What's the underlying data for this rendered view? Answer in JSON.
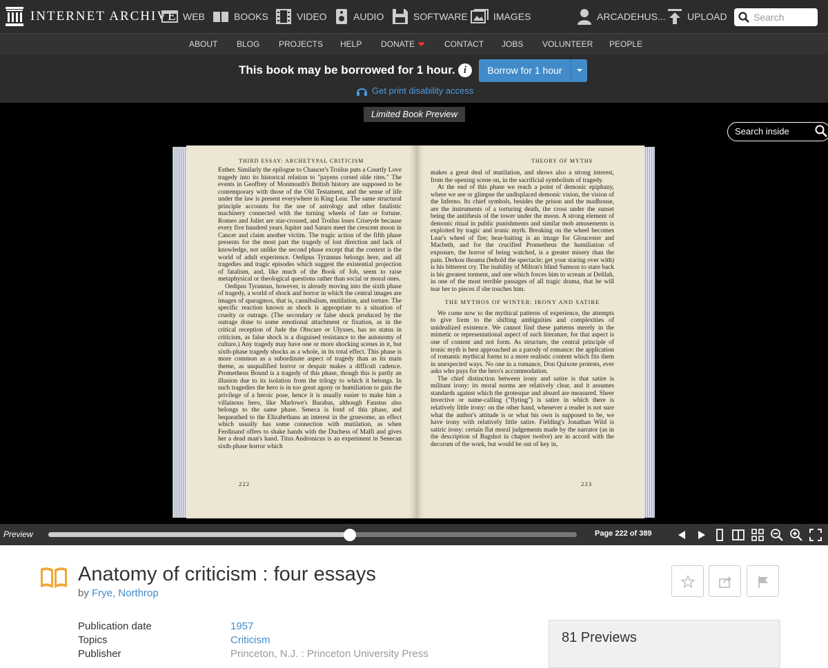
{
  "brand": {
    "name": "INTERNET ARCHIVE"
  },
  "topnav": {
    "items": [
      {
        "label": "WEB",
        "icon": "web-icon"
      },
      {
        "label": "BOOKS",
        "icon": "books-icon"
      },
      {
        "label": "VIDEO",
        "icon": "video-icon"
      },
      {
        "label": "AUDIO",
        "icon": "audio-icon"
      },
      {
        "label": "SOFTWARE",
        "icon": "software-icon"
      },
      {
        "label": "IMAGES",
        "icon": "images-icon"
      }
    ],
    "user": "ARCADEHUS...",
    "upload": "UPLOAD",
    "search_placeholder": "Search"
  },
  "subnav": {
    "items": [
      "ABOUT",
      "BLOG",
      "PROJECTS",
      "HELP",
      "DONATE",
      "CONTACT",
      "JOBS",
      "VOLUNTEER",
      "PEOPLE"
    ]
  },
  "borrow": {
    "message": "This book may be borrowed for 1 hour.",
    "button": "Borrow for 1 hour",
    "print_link": "Get print disability access"
  },
  "reader": {
    "preview_label": "Limited Book Preview",
    "search_inside": "Search inside",
    "left_page": {
      "running_head": "THIRD ESSAY: ARCHETYPAL CRITICISM",
      "paragraphs": [
        "Esther. Similarly the epilogue to Chaucer's Troilus puts a Courtly Love tragedy into its historical relation to \"payens corsed olde rites.\" The events in Geoffrey of Monmouth's British history are supposed to be contemporary with those of the Old Testament, and the sense of life under the law is present everywhere in King Lear. The same structural principle accounts for the use of astrology and other fatalistic machinery connected with the turning wheels of fate or fortune. Romeo and Juliet are star-crossed, and Troilus loses Criseyde because every five hundred years Jupiter and Saturn meet the crescent moon in Cancer and claim another victim. The tragic action of the fifth phase presents for the most part the tragedy of lost direction and lack of knowledge, not unlike the second phase except that the context is the world of adult experience. Oedipus Tyrannus belongs here, and all tragedies and tragic episodes which suggest the existential projection of fatalism, and, like much of the Book of Job, seem to raise metaphysical or theological questions rather than social or moral ones.",
        "Oedipus Tyrannus, however, is already moving into the sixth phase of tragedy, a world of shock and horror in which the central images are images of sparagmos, that is, cannibalism, mutilation, and torture. The specific reaction known as shock is appropriate to a situation of cruelty or outrage. (The secondary or false shock produced by the outrage done to some emotional attachment or fixation, as in the critical reception of Jude the Obscure or Ulysses, has no status in criticism, as false shock is a disguised resistance to the autonomy of culture.) Any tragedy may have one or more shocking scenes in it, but sixth-phase tragedy shocks as a whole, in its total effect. This phase is more common as a subordinate aspect of tragedy than as its main theme, as unqualified horror or despair makes a difficult cadence. Prometheus Bound is a tragedy of this phase, though this is partly an illusion due to its isolation from the trilogy to which it belongs. In such tragedies the hero is in too great agony or humiliation to gain the privilege of a heroic pose, hence it is usually easier to make him a villainous hero, like Marlowe's Barabas, although Faustus also belongs to the same phase. Seneca is fond of this phase, and bequeathed to the Elizabethans an interest in the gruesome, an effect which usually has some connection with mutilation, as when Ferdinand offers to shake hands with the Duchess of Malfi and gives her a dead man's hand. Titus Andronicus is an experiment in Senecan sixth-phase horror which"
      ],
      "folio": "222"
    },
    "right_page": {
      "running_head": "THEORY OF MYTHS",
      "paragraphs_a": [
        "makes a great deal of mutilation, and shows also a strong interest, from the opening scene on, in the sacrificial symbolism of tragedy.",
        "At the end of this phase we reach a point of demonic epiphany, where we see or glimpse the undisplaced demonic vision, the vision of the Inferno. Its chief symbols, besides the prison and the madhouse, are the instruments of a torturing death, the cross under the sunset being the antithesis of the tower under the moon. A strong element of demonic ritual in public punishments and similar mob amusements is exploited by tragic and ironic myth. Breaking on the wheel becomes Lear's wheel of fire; bear-baiting is an image for Gloucester and Macbeth, and for the crucified Prometheus the humiliation of exposure, the horror of being watched, is a greater misery than the pain. Derkou theama (behold the spectacle; get your staring over with) is his bitterest cry. The inability of Milton's blind Samson to stare back is his greatest torment, and one which forces him to scream at Delilah, in one of the most terrible passages of all tragic drama, that he will tear her to pieces if she touches him."
      ],
      "section_head": "THE MYTHOS OF WINTER: IRONY AND SATIRE",
      "paragraphs_b": [
        "We come now to the mythical patterns of experience, the attempts to give form to the shifting ambiguities and complexities of unidealized existence. We cannot find these patterns merely in the mimetic or representational aspect of such literature, for that aspect is one of content and not form. As structure, the central principle of ironic myth is best approached as a parody of romance: the application of romantic mythical forms to a more realistic content which fits them in unexpected ways. No one in a romance, Don Quixote protests, ever asks who pays for the hero's accommodation.",
        "The chief distinction between irony and satire is that satire is militant irony: its moral norms are relatively clear, and it assumes standards against which the grotesque and absurd are measured. Sheer invective or name-calling (\"flyting\") is satire in which there is relatively little irony: on the other hand, whenever a reader is not sure what the author's attitude is or what his own is supposed to be, we have irony with relatively little satire. Fielding's Jonathan Wild is satiric irony: certain flat moral judgements made by the narrator (as in the description of Bagshot in chapter twelve) are in accord with the decorum of the work, but would be out of key in,"
      ],
      "folio": "223"
    }
  },
  "controls": {
    "preview": "Preview",
    "page_indicator": "Page 222 of 389",
    "progress": {
      "current": 222,
      "total": 389
    }
  },
  "item": {
    "title": "Anatomy of criticism : four essays",
    "by_prefix": "by",
    "author": "Frye, Northrop",
    "metadata": [
      {
        "label": "Publication date",
        "value": "1957"
      },
      {
        "label": "Topics",
        "value": "Criticism"
      },
      {
        "label": "Publisher",
        "value": "Princeton, N.J. : Princeton University Press"
      }
    ],
    "stats": "81 Previews"
  },
  "colors": {
    "link": "#428bca",
    "borrow_button": "#428bca",
    "heart": "#f23131",
    "topbar": "#2c2c2c"
  }
}
